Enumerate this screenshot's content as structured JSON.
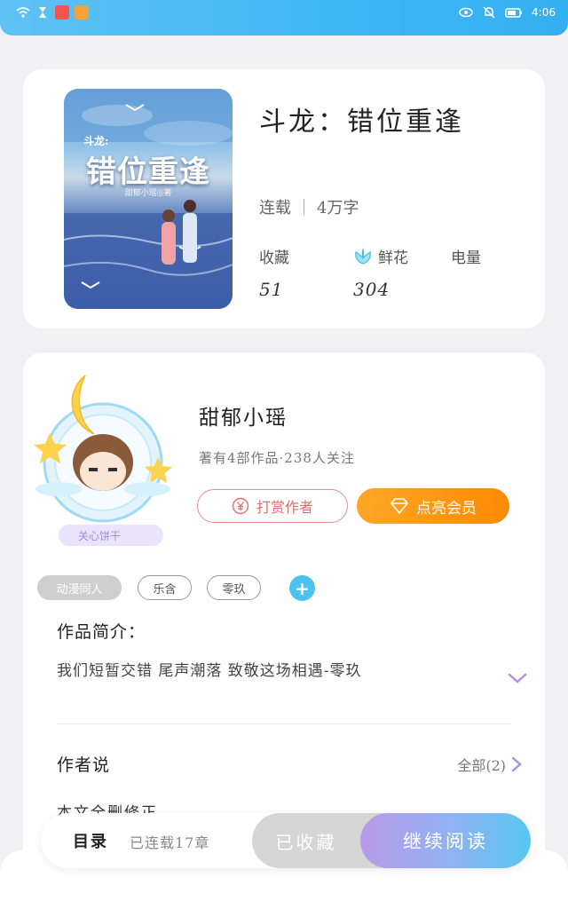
{
  "status_bar": {
    "time": "4:06"
  },
  "book": {
    "cover": {
      "series": "斗龙:",
      "title": "错位重逢",
      "author_credit": "甜郁小瑶◎著"
    },
    "title": "斗龙：错位重逢",
    "status": "连载",
    "word_count": "4万字",
    "stats": [
      {
        "label": "收藏",
        "value": "51",
        "icon": ""
      },
      {
        "label": "鲜花",
        "value": "304",
        "icon": "flower-icon"
      },
      {
        "label": "电量",
        "value": "",
        "icon": ""
      }
    ]
  },
  "author": {
    "name": "甜郁小瑶",
    "meta": "著有4部作品·238人关注",
    "avatar_caption": "关心饼干",
    "reward_label": "打赏作者",
    "vip_label": "点亮会员"
  },
  "tags": [
    "动漫同人",
    "乐含",
    "零玖"
  ],
  "intro": {
    "heading": "作品简介：",
    "text": "我们短暂交错 尾声潮落 致敬这场相遇-零玖"
  },
  "author_says": {
    "heading": "作者说",
    "all_label": "全部(2)",
    "preview": "本文全删修正"
  },
  "bottom_bar": {
    "toc_label": "目录",
    "chapter_count": "已连载17章",
    "collected_label": "已收藏",
    "continue_label": "继续阅读"
  }
}
